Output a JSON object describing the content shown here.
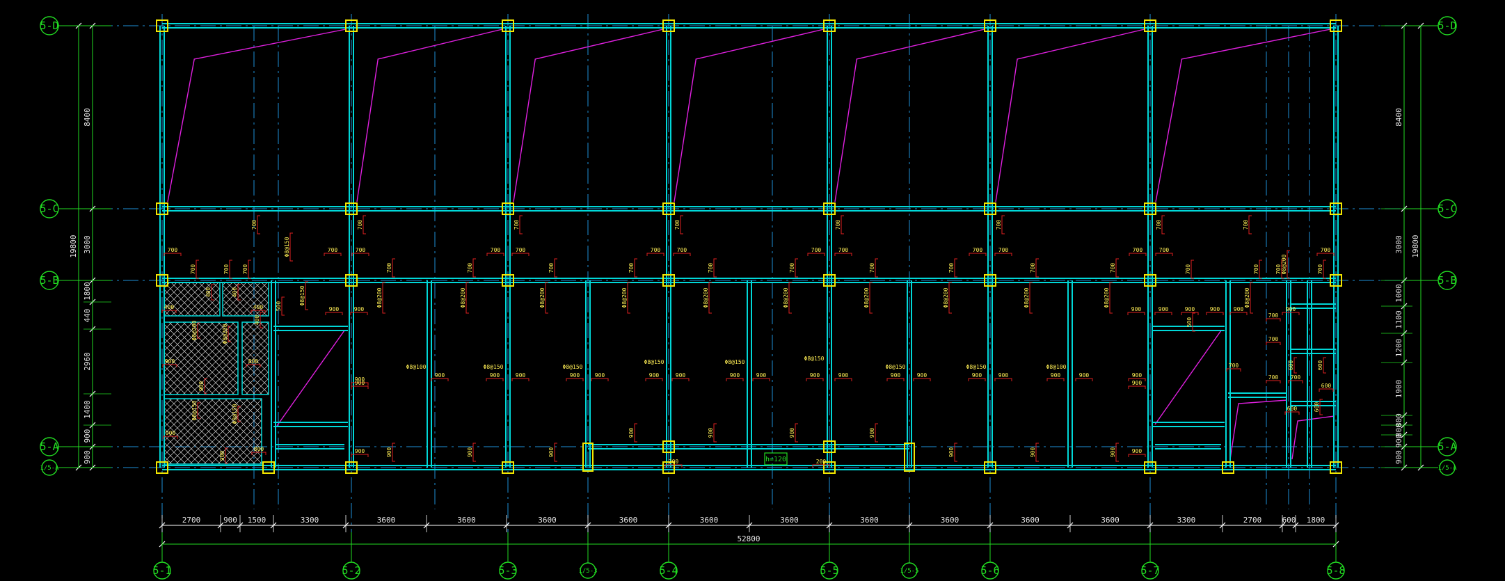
{
  "colors": {
    "background": "#000000",
    "beam": "#00d8d8",
    "beam_inner": "#0a8a90",
    "column": "#f2e600",
    "axis_green": "#22dd22",
    "centerline": "#1e8fd8",
    "dimension": "#ffffff",
    "slab_diagonal": "#e020e0",
    "rebar_red": "#e02020",
    "rebar_text": "#ffee55",
    "hatch": "#d0d0d0"
  },
  "vertical_axes": [
    {
      "id": "v1",
      "label": "5-1",
      "small": false
    },
    {
      "id": "v2",
      "label": "5-2",
      "small": false
    },
    {
      "id": "v3",
      "label": "5-3",
      "small": false
    },
    {
      "id": "v3a",
      "label": "1/5-3",
      "small": true
    },
    {
      "id": "v4",
      "label": "5-4",
      "small": false
    },
    {
      "id": "v5",
      "label": "5-5",
      "small": false
    },
    {
      "id": "v5a",
      "label": "1/5-5",
      "small": true
    },
    {
      "id": "v6",
      "label": "5-6",
      "small": false
    },
    {
      "id": "v7",
      "label": "5-7",
      "small": false
    },
    {
      "id": "v8",
      "label": "5-8",
      "small": false
    }
  ],
  "horizontal_axes": [
    {
      "id": "hD",
      "label": "5-D",
      "small": false
    },
    {
      "id": "hC",
      "label": "5-C",
      "small": false
    },
    {
      "id": "hB",
      "label": "5-B",
      "small": false
    },
    {
      "id": "hA",
      "label": "5-A",
      "small": false
    },
    {
      "id": "hA0",
      "label": "1/5-A",
      "small": true
    }
  ],
  "bottom_dimensions": [
    "2700",
    "900",
    "1500",
    "3300",
    "3600",
    "3600",
    "3600",
    "3600",
    "3600",
    "3600",
    "3600",
    "3600",
    "3600",
    "3600",
    "3300",
    "2700",
    "600",
    "1800"
  ],
  "bottom_total": "52800",
  "left_dimensions": [
    "8400",
    "3000",
    "1800",
    "440",
    "2960",
    "1400",
    "900",
    "900"
  ],
  "left_total": "19800",
  "right_dimensions": [
    "8400",
    "3000",
    "1000",
    "1100",
    "1200",
    "1900",
    "800",
    "800",
    "900",
    "900"
  ],
  "right_total": "19800",
  "slab_tag": "h=120",
  "rebar_labels": {
    "l700": "700",
    "l900": "900",
    "l800": "800",
    "l600": "600",
    "l500": "500",
    "l400": "400",
    "l200": "200",
    "s150": "Φ8@150",
    "s200": "Φ8@200",
    "s100": "Φ8@100",
    "s150h": "Φ8@150"
  }
}
